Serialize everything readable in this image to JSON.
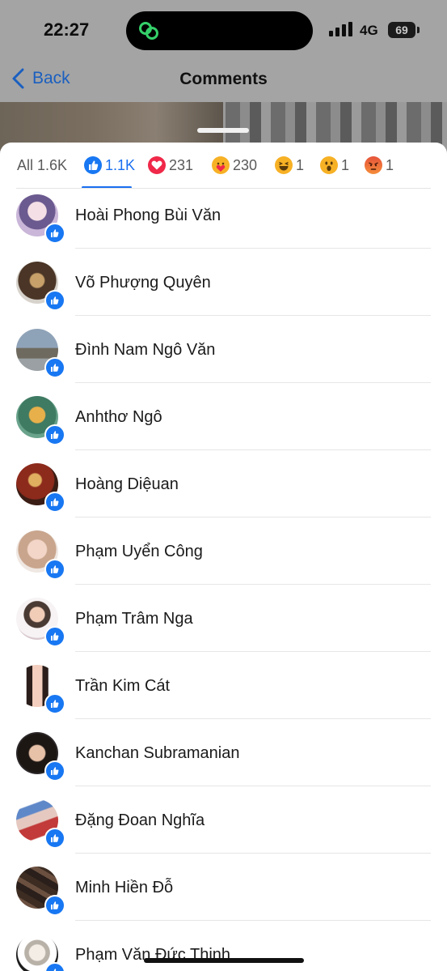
{
  "status_bar": {
    "time": "22:27",
    "network": "4G",
    "battery": "69"
  },
  "nav": {
    "back_label": "Back",
    "title": "Comments"
  },
  "tabs": [
    {
      "label": "All 1.6K",
      "icon": ""
    },
    {
      "label": "1.1K",
      "icon": "like-icon"
    },
    {
      "label": "231",
      "icon": "love-icon"
    },
    {
      "label": "230",
      "icon": "care-icon"
    },
    {
      "label": "1",
      "icon": "haha-icon"
    },
    {
      "label": "1",
      "icon": "wow-icon"
    },
    {
      "label": "1",
      "icon": "angry-icon"
    }
  ],
  "active_tab": "1.1K",
  "reactors": [
    {
      "name": "Hoài Phong Bùi Văn"
    },
    {
      "name": "Võ Phượng Quyên"
    },
    {
      "name": "Đình Nam Ngô Văn"
    },
    {
      "name": "Anhthơ Ngô"
    },
    {
      "name": "Hoàng Diệuan"
    },
    {
      "name": "Phạm Uyển Công"
    },
    {
      "name": "Phạm Trâm Nga"
    },
    {
      "name": "Trần Kim Cát"
    },
    {
      "name": "Kanchan Subramanian"
    },
    {
      "name": "Đặng Đoan Nghĩa"
    },
    {
      "name": "Minh Hiền Đỗ"
    },
    {
      "name": "Phạm Văn Đức Thịnh"
    }
  ],
  "colors": {
    "accent": "#1a6ff0",
    "like": "#1877f2",
    "love": "#f02849",
    "reaction_yellow": "#f7b125"
  }
}
